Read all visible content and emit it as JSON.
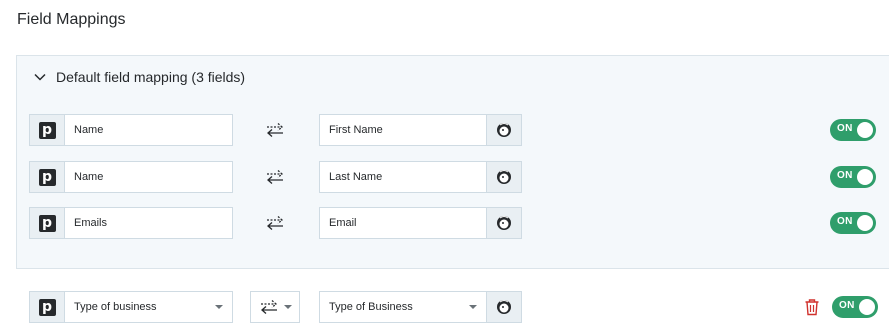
{
  "page": {
    "title": "Field Mappings"
  },
  "panel": {
    "title": "Default field mapping (3 fields)",
    "rows": [
      {
        "source": "Name",
        "target": "First Name",
        "toggle": "ON"
      },
      {
        "source": "Name",
        "target": "Last Name",
        "toggle": "ON"
      },
      {
        "source": "Emails",
        "target": "Email",
        "toggle": "ON"
      }
    ]
  },
  "custom_row": {
    "source": "Type of business",
    "target": "Type of Business",
    "toggle": "ON"
  },
  "icons": {
    "source_app": "pipedrive-logo-icon",
    "target_app": "mailchimp-logo-icon",
    "swap": "swap-arrows-icon",
    "delete": "trash-icon",
    "collapse": "chevron-down-icon"
  },
  "colors": {
    "toggle_on": "#2f9e6b",
    "panel_bg": "#f4f8fb",
    "delete_red": "#d0312d"
  }
}
